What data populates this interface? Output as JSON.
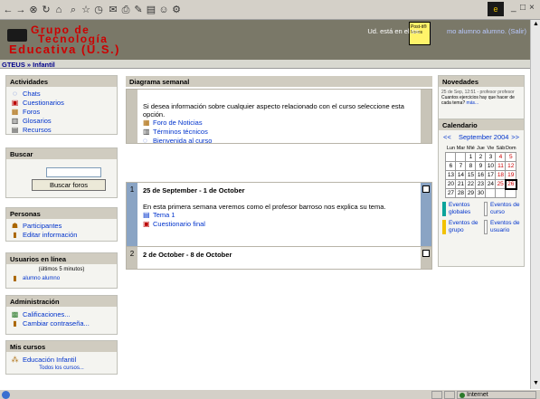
{
  "browser": {
    "window_controls": [
      "_",
      "□",
      "×"
    ],
    "status_zone": "Internet"
  },
  "header": {
    "logo_line1": "Grupo de",
    "logo_line2": "Tecnología",
    "logo_line3": "Educativa (U.S.)",
    "login_prefix": "Ud. está en el sis",
    "login_user": "mo alumno alumno.",
    "login_exit": "(Salir)",
    "postit": "Post-it® Notes"
  },
  "breadcrumb": "GTEUS » Infantil",
  "actividades": {
    "title": "Actividades",
    "items": [
      "Chats",
      "Cuestionarios",
      "Foros",
      "Glosarios",
      "Recursos"
    ]
  },
  "buscar": {
    "title": "Buscar",
    "button": "Buscar foros"
  },
  "personas": {
    "title": "Personas",
    "items": [
      "Participantes",
      "Editar información"
    ]
  },
  "usuarios": {
    "title": "Usuarios en línea",
    "subtitle": "(últimos 5 minutos)",
    "user": "alumno alumno"
  },
  "administracion": {
    "title": "Administración",
    "items": [
      "Calificaciones...",
      "Cambiar contraseña..."
    ]
  },
  "miscursos": {
    "title": "Mis cursos",
    "course": "Educación Infantil",
    "all": "Todos los cursos..."
  },
  "center": {
    "title": "Diagrama semanal",
    "intro": "Si desea información sobre cualquier aspecto relacionado con el curso seleccione esta opción.",
    "intro_links": [
      "Foro de Noticias",
      "Términos técnicos",
      "Bienvenida al curso"
    ],
    "week1_num": "1",
    "week1_title": "25 de September - 1 de October",
    "week1_text": "En esta primera semana veremos como el profesor barroso nos explica su tema.",
    "week1_links": [
      "Tema 1",
      "Cuestionario final"
    ],
    "week2_num": "2",
    "week2_title": "2 de October - 8 de October"
  },
  "novedades": {
    "title": "Novedades",
    "date": "25 de Sep, 12:51 - profesor profesor",
    "text": "Cuantos ejercicios hay que hacer de cada tema?",
    "more": "más..."
  },
  "calendario": {
    "title": "Calendario",
    "prev": "<<",
    "month": "September 2004",
    "next": ">>",
    "days": [
      "Lun",
      "Mar",
      "Mié",
      "Jue",
      "Vie",
      "Sáb",
      "Dom"
    ],
    "weeks": [
      [
        "",
        "",
        "1",
        "2",
        "3",
        "4",
        "5"
      ],
      [
        "6",
        "7",
        "8",
        "9",
        "10",
        "11",
        "12"
      ],
      [
        "13",
        "14",
        "15",
        "16",
        "17",
        "18",
        "19"
      ],
      [
        "20",
        "21",
        "22",
        "23",
        "24",
        "25",
        "26"
      ],
      [
        "27",
        "28",
        "29",
        "30",
        "",
        "",
        ""
      ]
    ],
    "legend": [
      "Eventos globales",
      "Eventos de curso",
      "Eventos de grupo",
      "Eventos de usuario"
    ],
    "legend_colors": [
      "#0aa39a",
      "#ffffff",
      "#f2c200",
      "#ffffff"
    ]
  },
  "colors": {
    "header_bg": "#7a7868",
    "link": "#0033cc",
    "week1_bar": "#8aa4c4",
    "logo_red": "#cc0000"
  }
}
